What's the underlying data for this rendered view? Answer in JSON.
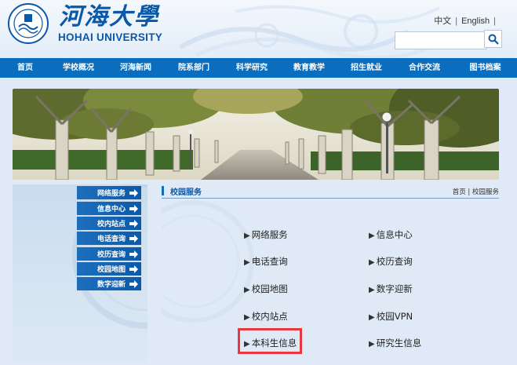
{
  "header": {
    "logo_cn": "河海大學",
    "logo_en": "HOHAI UNIVERSITY",
    "lang_cn": "中文",
    "lang_sep": "|",
    "lang_en": "English",
    "lang_sep2": "|",
    "search_placeholder": ""
  },
  "nav": {
    "items": [
      "首页",
      "学校概况",
      "河海新闻",
      "院系部门",
      "科学研究",
      "教育教学",
      "招生就业",
      "合作交流",
      "图书档案"
    ]
  },
  "sidebar": {
    "items": [
      "网络服务",
      "信息中心",
      "校内站点",
      "电话查询",
      "校历查询",
      "校园地图",
      "数字迎新"
    ]
  },
  "main": {
    "title": "校园服务",
    "breadcrumb": "首页 | 校园服务",
    "services": [
      [
        "网络服务",
        "信息中心"
      ],
      [
        "电话查询",
        "校历查询"
      ],
      [
        "校园地图",
        "数字迎新"
      ],
      [
        "校内站点",
        "校园VPN"
      ],
      [
        "本科生信息",
        "研究生信息"
      ]
    ]
  },
  "colors": {
    "nav_bg": "#0b6dbe",
    "brand_blue": "#0a58a8",
    "highlight": "#e8383d"
  }
}
